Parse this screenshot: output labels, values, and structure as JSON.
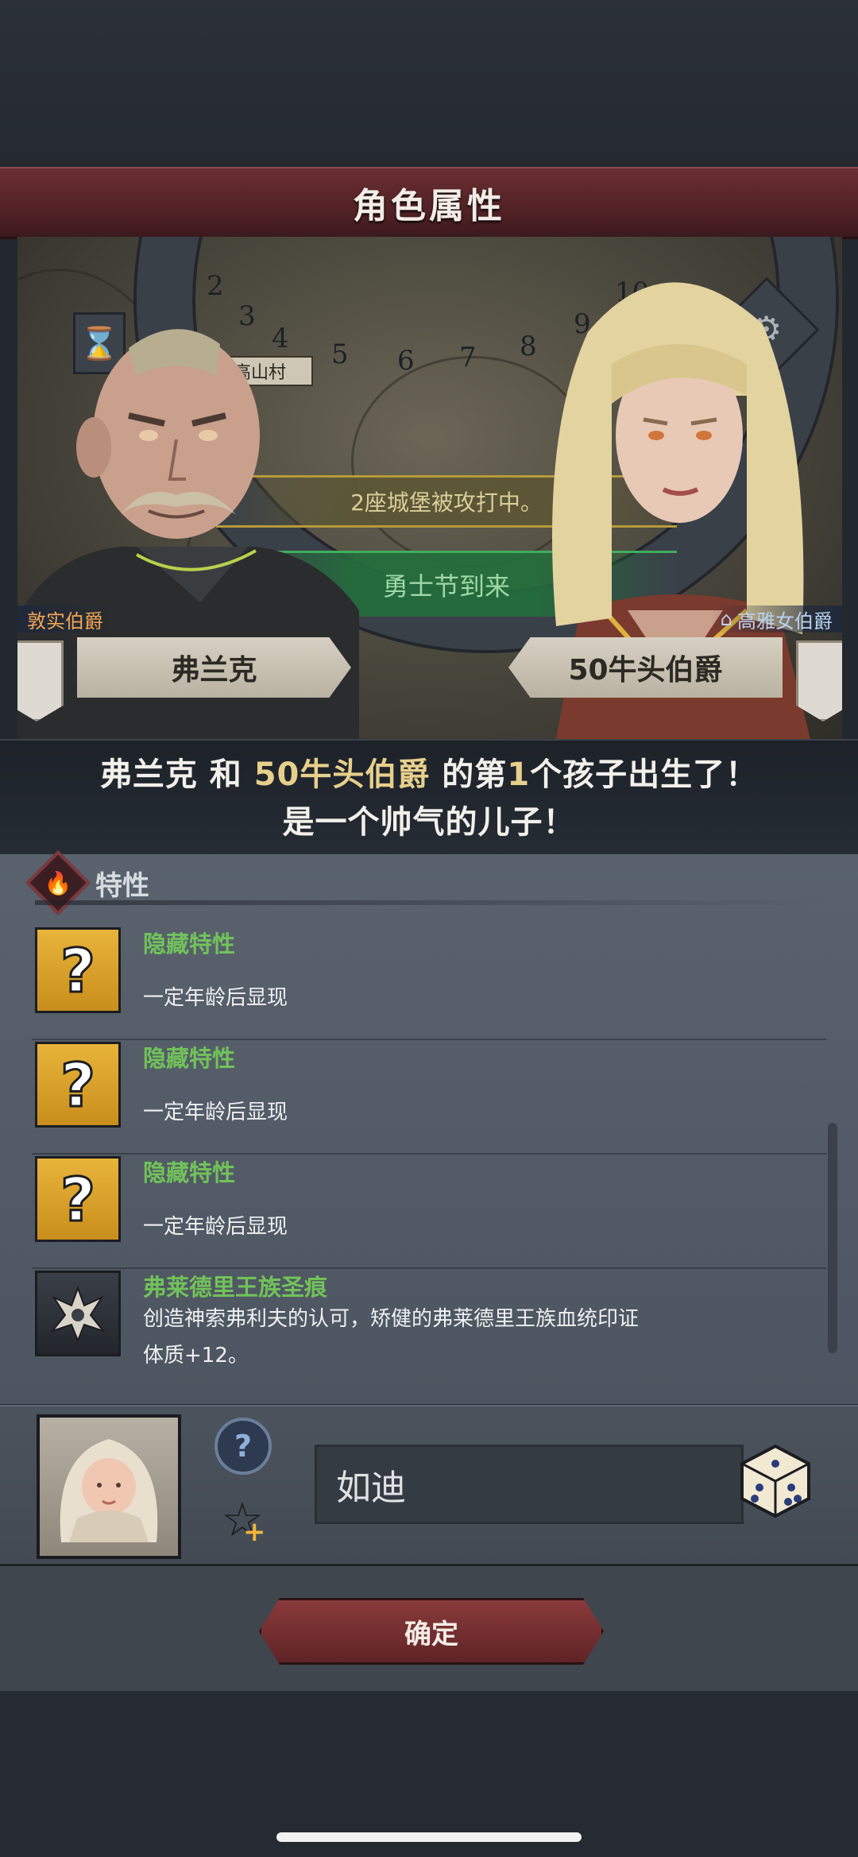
{
  "header": {
    "title": "角色属性"
  },
  "scene": {
    "village": "高山村",
    "dial_numbers": [
      "2",
      "3",
      "4",
      "5",
      "6",
      "7",
      "8",
      "9",
      "10"
    ],
    "events": [
      "2座城堡被攻打中。",
      "勇士节到来"
    ]
  },
  "parents": {
    "father": {
      "rank": "敦实伯爵",
      "name": "弗兰克"
    },
    "mother": {
      "rank": "高雅女伯爵",
      "name": "50牛头伯爵"
    }
  },
  "announcement": {
    "line1_a": "弗兰克",
    "line1_b": " 和 ",
    "line1_c": "50牛头伯爵",
    "line1_d": " 的第",
    "line1_e": "1",
    "line1_f": "个孩子出生了！",
    "line2": "是一个帅气的儿子！"
  },
  "traits_section": {
    "title": "特性",
    "items": [
      {
        "name": "隐藏特性",
        "desc": "一定年龄后显现",
        "icon": "question-mark"
      },
      {
        "name": "隐藏特性",
        "desc": "一定年龄后显现",
        "icon": "question-mark"
      },
      {
        "name": "隐藏特性",
        "desc": "一定年龄后显现",
        "icon": "question-mark"
      },
      {
        "name": "弗莱德里王族圣痕",
        "desc": "创造神索弗利夫的认可，矫健的弗莱德里王族血统印证",
        "desc2": "体质+12。",
        "icon": "royal-crest"
      }
    ]
  },
  "child": {
    "name_value": "如迪",
    "help_icon": "?",
    "favorite_icon": "star-plus"
  },
  "footer": {
    "confirm_label": "确定"
  },
  "colors": {
    "title_bar": "#4e2024",
    "trait_name": "#71c25a",
    "confirm": "#7a3030"
  }
}
